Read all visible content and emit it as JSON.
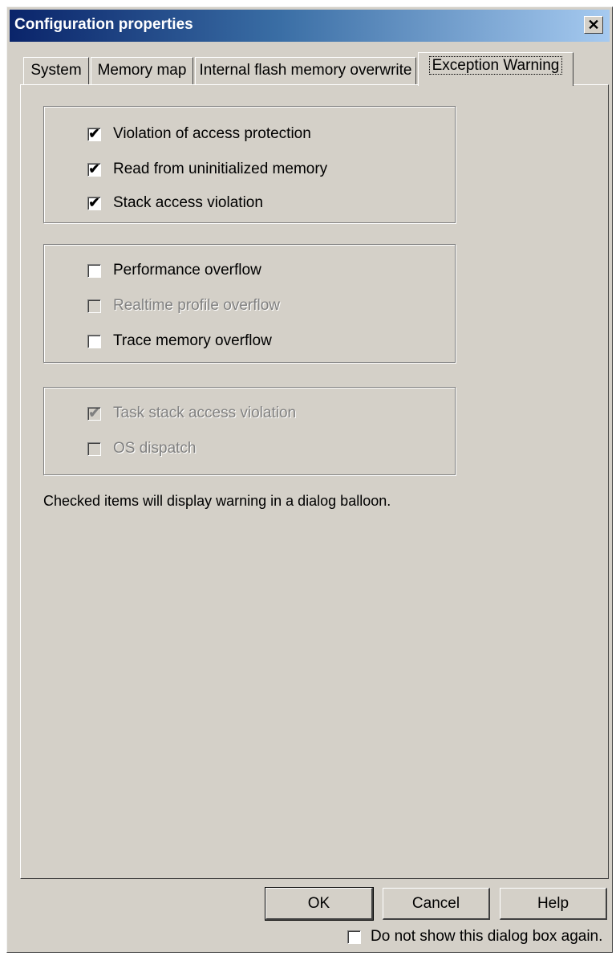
{
  "window": {
    "title": "Configuration properties",
    "close_glyph": "✕"
  },
  "tabs": [
    {
      "label": "System",
      "active": false
    },
    {
      "label": "Memory map",
      "active": false
    },
    {
      "label": "Internal flash memory overwrite",
      "active": false
    },
    {
      "label": "Exception Warning",
      "active": true
    }
  ],
  "groups": [
    {
      "items": [
        {
          "label": "Violation of access protection",
          "checked": true,
          "enabled": true
        },
        {
          "label": "Read from uninitialized memory",
          "checked": true,
          "enabled": true
        },
        {
          "label": "Stack access violation",
          "checked": true,
          "enabled": true
        }
      ]
    },
    {
      "items": [
        {
          "label": "Performance overflow",
          "checked": false,
          "enabled": true
        },
        {
          "label": "Realtime profile overflow",
          "checked": false,
          "enabled": false
        },
        {
          "label": "Trace memory overflow",
          "checked": false,
          "enabled": true
        }
      ]
    },
    {
      "items": [
        {
          "label": "Task stack access violation",
          "checked": true,
          "enabled": false
        },
        {
          "label": "OS dispatch",
          "checked": false,
          "enabled": false
        }
      ]
    }
  ],
  "note": "Checked items will display warning in a dialog balloon.",
  "buttons": {
    "ok": "OK",
    "cancel": "Cancel",
    "help": "Help"
  },
  "footer": {
    "dont_show_label": "Do not show this dialog box again.",
    "dont_show_checked": false
  },
  "check_glyph": "✔",
  "colors": {
    "title_gradient_start": "#0a246a",
    "title_gradient_end": "#a6caf0",
    "face": "#d4d0c8",
    "disabled_text": "#808080"
  }
}
